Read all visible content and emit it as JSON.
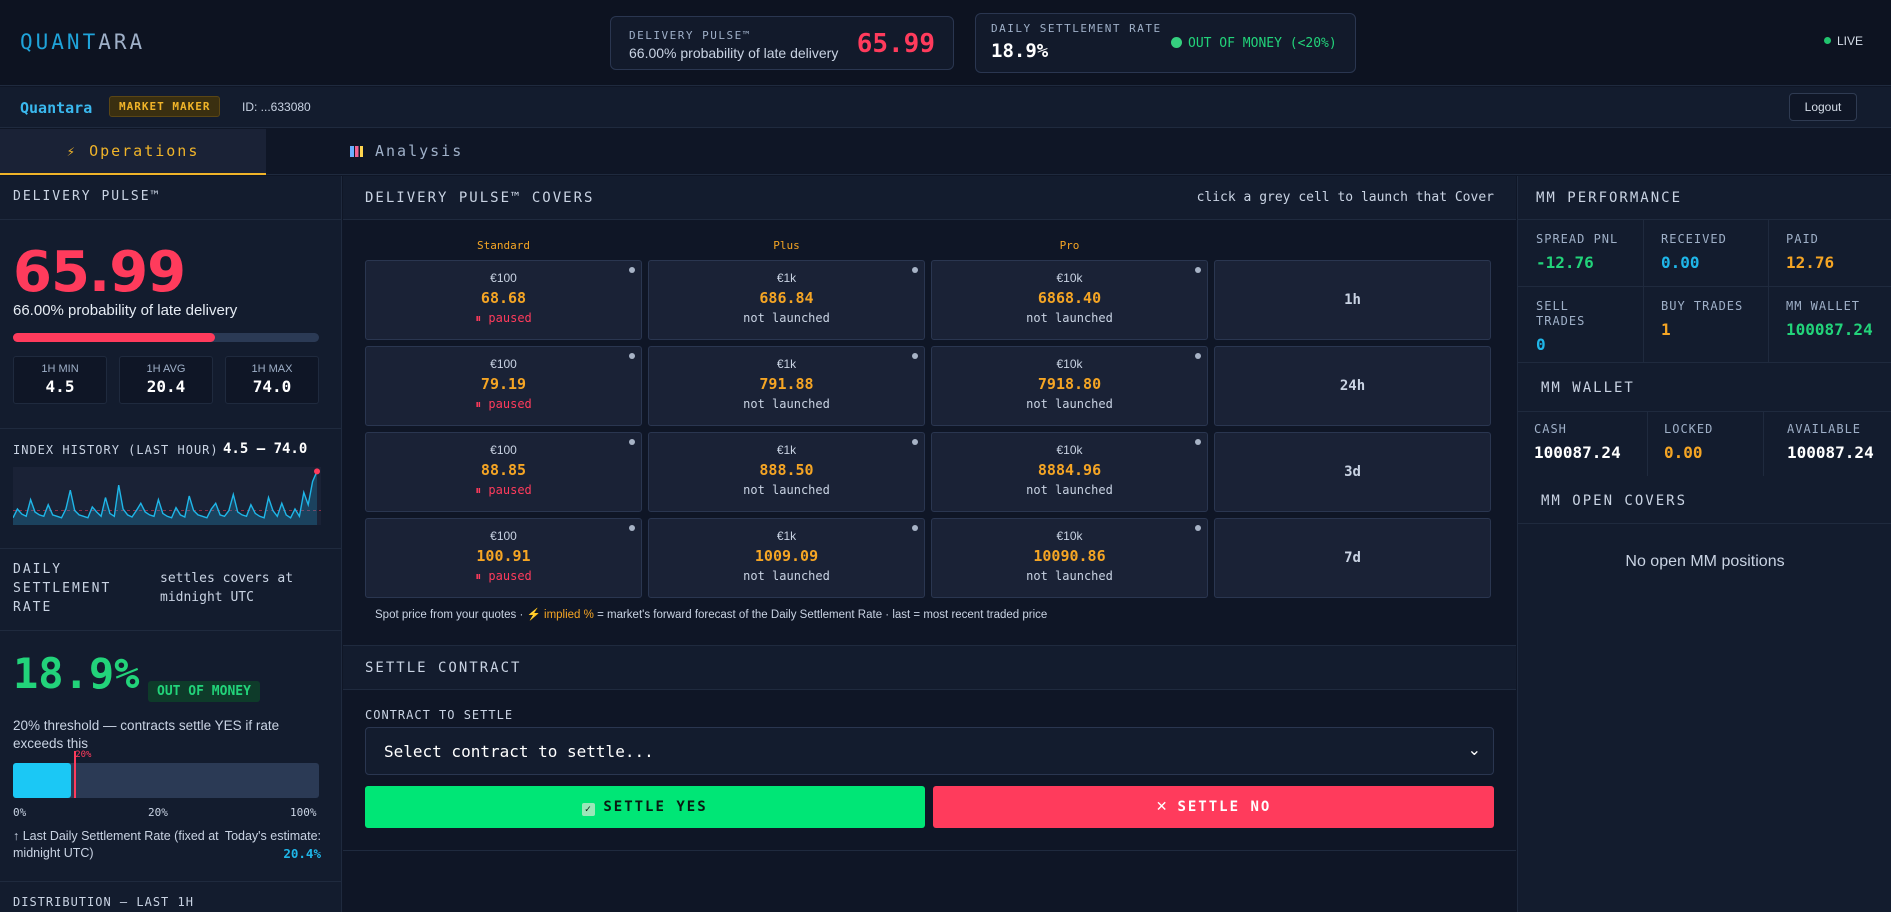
{
  "brand": {
    "part1": "QUANT",
    "part2": "ARA"
  },
  "header": {
    "pulse_label": "DELIVERY PULSE™",
    "pulse_sub": "66.00% probability of late delivery",
    "pulse_value": "65.99",
    "rate_label": "DAILY SETTLEMENT RATE",
    "rate_value": "18.9%",
    "rate_status": "OUT OF MONEY (<20%)",
    "live": "LIVE"
  },
  "userbar": {
    "name": "Quantara",
    "role": "MARKET MAKER",
    "id": "ID: ...633080",
    "logout": "Logout"
  },
  "tabs": [
    {
      "icon": "⚡",
      "label": "Operations"
    },
    {
      "icon": "📊",
      "label": "Analysis"
    }
  ],
  "left": {
    "pulse_title": "DELIVERY PULSE™",
    "pulse_value": "65.99",
    "pulse_prob": "66.00% probability of late delivery",
    "pulse_fraction": 0.66,
    "stats": [
      {
        "label": "1H MIN",
        "value": "4.5"
      },
      {
        "label": "1H AVG",
        "value": "20.4"
      },
      {
        "label": "1H MAX",
        "value": "74.0"
      }
    ],
    "history_title": "INDEX HISTORY (LAST HOUR)",
    "history_range": "4.5 – 74.0",
    "history_values": [
      10,
      22,
      15,
      12,
      35,
      18,
      14,
      12,
      28,
      14,
      12,
      10,
      22,
      48,
      20,
      14,
      12,
      10,
      25,
      18,
      12,
      38,
      16,
      12,
      55,
      22,
      14,
      11,
      20,
      30,
      18,
      14,
      12,
      35,
      16,
      12,
      10,
      24,
      14,
      11,
      40,
      20,
      14,
      12,
      10,
      22,
      30,
      14,
      12,
      20,
      42,
      18,
      14,
      12,
      28,
      16,
      12,
      10,
      38,
      20,
      12,
      30,
      14,
      10,
      22,
      12,
      45,
      28,
      60,
      74
    ],
    "dsr_title": "DAILY SETTLEMENT RATE",
    "dsr_desc": "settles covers at midnight UTC",
    "dsr_value": "18.9%",
    "dsr_badge": "OUT OF MONEY",
    "dsr_threshold_text": "20% threshold — contracts settle YES if rate exceeds this",
    "dsr_bar_fraction": 0.189,
    "dsr_threshold_fraction": 0.2,
    "dsr_threshold_mark": "20%",
    "dsr_ticks": [
      "0%",
      "20%",
      "100%"
    ],
    "dsr_last": "↑ Last Daily Settlement Rate (fixed at midnight UTC)",
    "dsr_today_label": "Today's estimate:",
    "dsr_today_value": "20.4%",
    "distribution_title": "DISTRIBUTION — LAST 1H"
  },
  "covers": {
    "title": "DELIVERY PULSE™ COVERS",
    "hint": "click a grey cell to launch that Cover",
    "columns": [
      "Standard",
      "Plus",
      "Pro"
    ],
    "rows": [
      {
        "term": "1h",
        "cells": [
          {
            "notional": "€100",
            "price": "68.68",
            "status": "⏸ paused",
            "paused": true
          },
          {
            "notional": "€1k",
            "price": "686.84",
            "status": "not launched",
            "paused": false
          },
          {
            "notional": "€10k",
            "price": "6868.40",
            "status": "not launched",
            "paused": false
          }
        ]
      },
      {
        "term": "24h",
        "cells": [
          {
            "notional": "€100",
            "price": "79.19",
            "status": "⏸ paused",
            "paused": true
          },
          {
            "notional": "€1k",
            "price": "791.88",
            "status": "not launched",
            "paused": false
          },
          {
            "notional": "€10k",
            "price": "7918.80",
            "status": "not launched",
            "paused": false
          }
        ]
      },
      {
        "term": "3d",
        "cells": [
          {
            "notional": "€100",
            "price": "88.85",
            "status": "⏸ paused",
            "paused": true
          },
          {
            "notional": "€1k",
            "price": "888.50",
            "status": "not launched",
            "paused": false
          },
          {
            "notional": "€10k",
            "price": "8884.96",
            "status": "not launched",
            "paused": false
          }
        ]
      },
      {
        "term": "7d",
        "cells": [
          {
            "notional": "€100",
            "price": "100.91",
            "status": "⏸ paused",
            "paused": true
          },
          {
            "notional": "€1k",
            "price": "1009.09",
            "status": "not launched",
            "paused": false
          },
          {
            "notional": "€10k",
            "price": "10090.86",
            "status": "not launched",
            "paused": false
          }
        ]
      }
    ],
    "footnote_a": "Spot price from your quotes ·",
    "footnote_b": "⚡ implied %",
    "footnote_c": "= market's forward forecast of the Daily Settlement Rate · last = most recent traded price"
  },
  "settle": {
    "title": "SETTLE CONTRACT",
    "field_label": "CONTRACT TO SETTLE",
    "select_value": "Select contract to settle...",
    "yes_label": "SETTLE YES",
    "no_label": "SETTLE NO"
  },
  "right": {
    "perf_title": "MM PERFORMANCE",
    "perf": [
      {
        "label": "SPREAD PNL",
        "value": "-12.76",
        "color": "#22d37a"
      },
      {
        "label": "RECEIVED",
        "value": "0.00",
        "color": "#1fb6e8"
      },
      {
        "label": "PAID",
        "value": "12.76",
        "color": "#f5a524"
      },
      {
        "label": "SELL TRADES",
        "value": "0",
        "color": "#1fb6e8"
      },
      {
        "label": "BUY TRADES",
        "value": "1",
        "color": "#f5a524"
      },
      {
        "label": "MM WALLET",
        "value": "100087.24",
        "color": "#22d37a"
      }
    ],
    "wallet_title": "MM WALLET",
    "wallet": [
      {
        "label": "CASH",
        "value": "100087.24",
        "color": "#ffffff"
      },
      {
        "label": "LOCKED",
        "value": "0.00",
        "color": "#f5a524"
      },
      {
        "label": "AVAILABLE",
        "value": "100087.24",
        "color": "#ffffff"
      }
    ],
    "open_title": "MM OPEN COVERS",
    "open_empty": "No open MM positions"
  }
}
